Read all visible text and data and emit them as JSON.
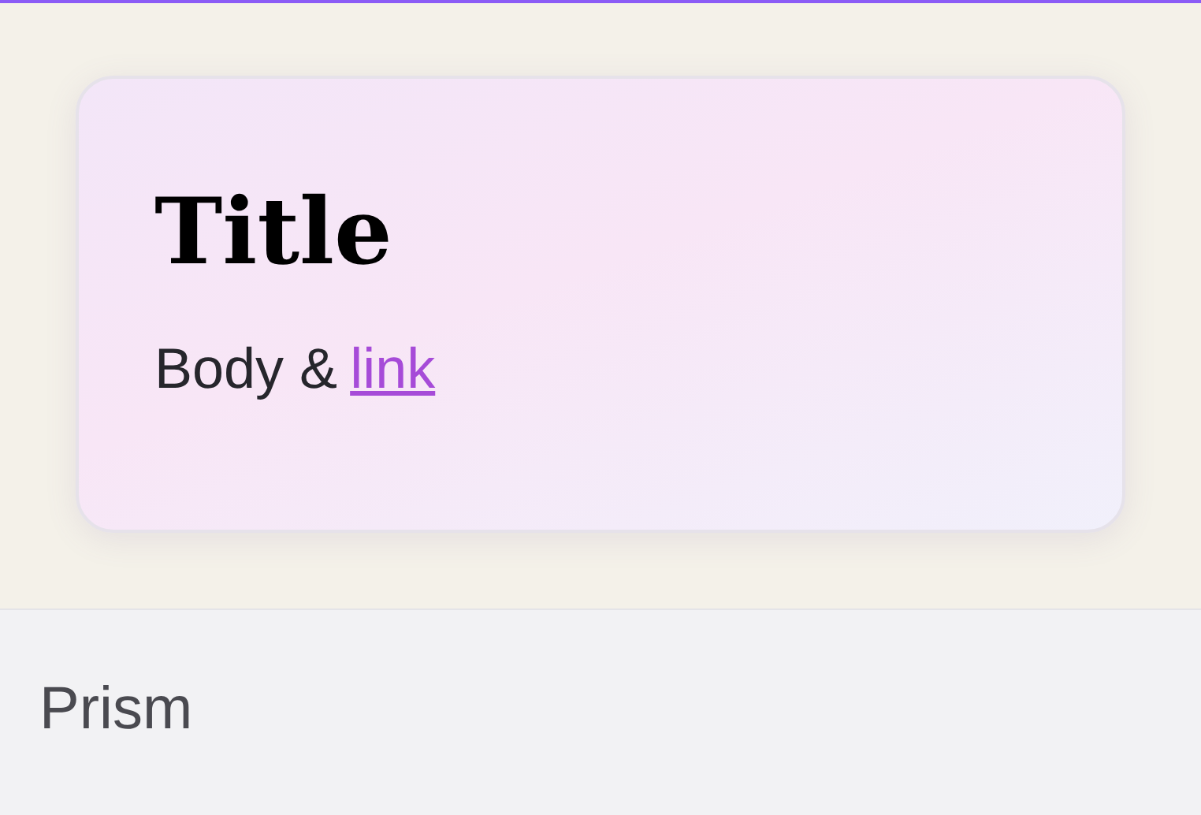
{
  "card": {
    "title": "Title",
    "body": "Body &",
    "link": "link"
  },
  "footer": {
    "label": "Prism"
  }
}
